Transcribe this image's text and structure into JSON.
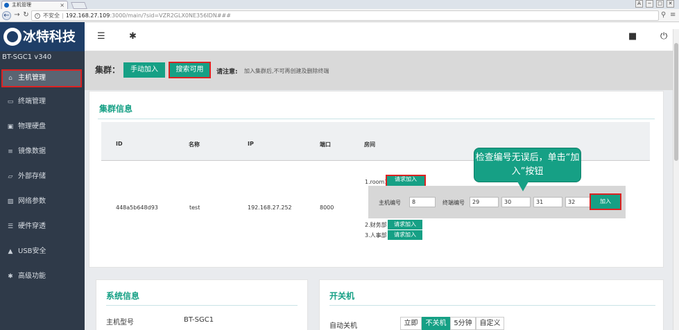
{
  "browser": {
    "tab_title": "主机管理",
    "tab_close": "×",
    "window_controls": [
      "A",
      "−",
      "□",
      "✕"
    ],
    "url_security": "不安全",
    "url_host": "192.168.27.109",
    "url_path": ":3000/main/?sid=VZR2GLX0NE356IDN###"
  },
  "header": {
    "brand": "冰特科技"
  },
  "sidebar": {
    "device": "BT-SGC1  v340",
    "items": [
      {
        "label": "主机管理",
        "icon": "home-icon",
        "glyph": "⌂"
      },
      {
        "label": "终端管理",
        "icon": "monitor-icon",
        "glyph": "▭"
      },
      {
        "label": "物理硬盘",
        "icon": "disk-icon",
        "glyph": "▣"
      },
      {
        "label": "镜像数据",
        "icon": "database-icon",
        "glyph": "≡"
      },
      {
        "label": "外部存储",
        "icon": "folder-icon",
        "glyph": "▱"
      },
      {
        "label": "网络参数",
        "icon": "network-icon",
        "glyph": "▨"
      },
      {
        "label": "硬件穿透",
        "icon": "list-icon",
        "glyph": "☰"
      },
      {
        "label": "USB安全",
        "icon": "lock-icon",
        "glyph": "▲"
      },
      {
        "label": "高级功能",
        "icon": "gear-icon",
        "glyph": "✱"
      }
    ]
  },
  "cluster": {
    "title": "集群：",
    "manual_join": "手动加入",
    "search_available": "搜索可用",
    "notice_label": "请注意:",
    "notice_text": "加入集群后,不可再创建及删除终端"
  },
  "cluster_info": {
    "title": "集群信息",
    "columns": [
      "ID",
      "名称",
      "IP",
      "端口",
      "房间"
    ],
    "row": {
      "id": "448a5b648d93",
      "name": "test",
      "ip": "192.168.27.252",
      "port": "8000"
    },
    "rooms": [
      {
        "label": "1.room1",
        "button": "请求加入"
      },
      {
        "label": "2.财务部",
        "button": "请求加入"
      },
      {
        "label": "3.人事部",
        "button": "请求加入"
      }
    ],
    "host_row": {
      "host_no_label": "主机编号",
      "host_no": "8",
      "terminal_no_label": "终端编号",
      "terminals": [
        "29",
        "30",
        "31",
        "32"
      ],
      "join_button": "加入"
    },
    "callout": "检查编号无误后，单击“加入”按钮"
  },
  "system_info": {
    "title": "系统信息",
    "model_label": "主机型号",
    "model_value": "BT-SGC1"
  },
  "power": {
    "title": "开关机",
    "auto_shutdown_label": "自动关机",
    "options": [
      "立即",
      "不关机",
      "5分钟",
      "自定义"
    ],
    "selected": "不关机"
  },
  "colors": {
    "accent": "#16a085",
    "sidebar": "#2f3a49",
    "brand": "#1f3e67",
    "highlight": "#dd2222"
  }
}
